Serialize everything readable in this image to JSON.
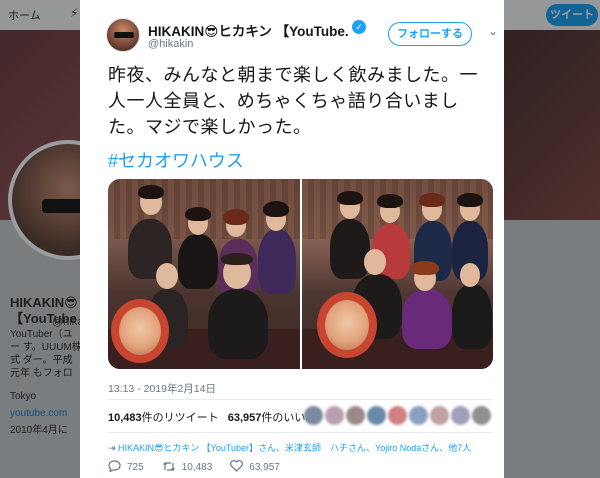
{
  "background": {
    "nav": {
      "home": "ホーム",
      "moments": "⚡",
      "tweet_button": "ツイート"
    },
    "profile": {
      "name": "HIKAKIN😎",
      "name2": "【YouTube",
      "handle": "@hikakin",
      "bio": "YouTuber（ユー す。UUUM株式 ダー。平成元年 もフォロー是非",
      "location": "Tokyo",
      "url": "youtube.com",
      "joined": "2010年4月に"
    }
  },
  "tweet": {
    "display_name": "HIKAKIN😎ヒカキン 【YouTube...",
    "verified_mark": "✓",
    "handle": "@hikakin",
    "follow_label": "フォローする",
    "caret": "⌄",
    "text": "昨夜、みんなと朝まで楽しく飲みました。一人一人全員と、めちゃくちゃ語り合いました。マジで楽しかった。",
    "hashtag": "#セカオワハウス",
    "timestamp": "13:13 - 2019年2月14日",
    "retweets_count": "10,483",
    "retweets_label": "件のリツイート",
    "likes_count": "63,957",
    "likes_label": "件のいいね",
    "reply_prefix": "HIKAKIN😎ヒカキン 【YouTuber】さん、米津玄師　ハチさん、Yojiro Nodaさん、他7人",
    "actions": {
      "reply_count": "725",
      "retweet_count": "10,483",
      "like_count": "63,957"
    },
    "icons": {
      "reply": "speech-bubble-icon",
      "retweet": "retweet-icon",
      "like": "heart-icon"
    }
  },
  "colors": {
    "accent": "#1da1f2",
    "text": "#14171a",
    "muted": "#657786"
  }
}
